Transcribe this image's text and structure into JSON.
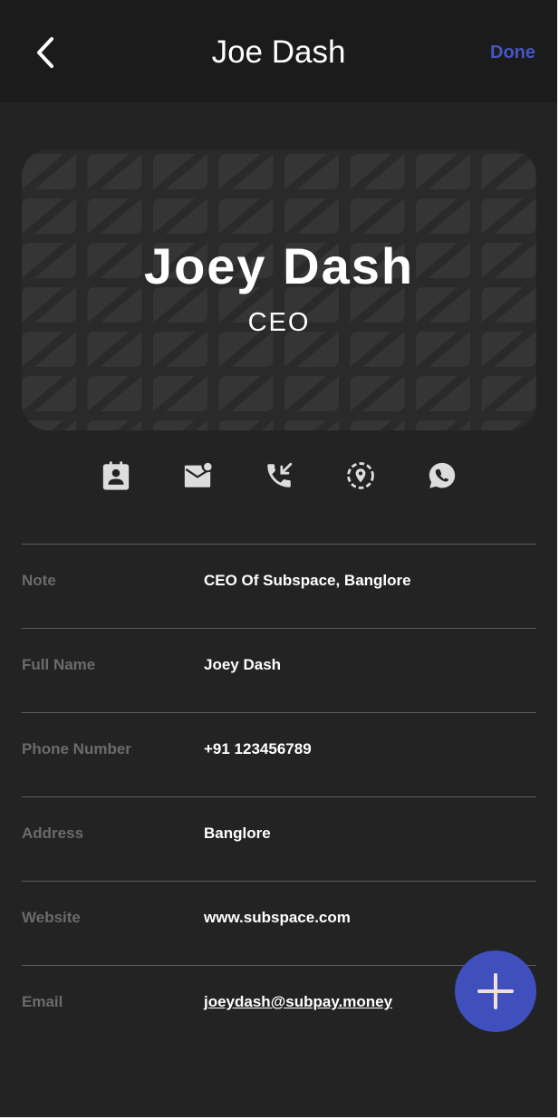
{
  "header": {
    "title": "Joe Dash",
    "done_label": "Done",
    "back_icon": "chevron-left-icon"
  },
  "card": {
    "name": "Joey Dash",
    "role": "CEO"
  },
  "actions": [
    {
      "icon": "contact-card-icon"
    },
    {
      "icon": "mail-notification-icon"
    },
    {
      "icon": "phone-callback-icon"
    },
    {
      "icon": "location-pin-icon"
    },
    {
      "icon": "whatsapp-icon"
    }
  ],
  "details": [
    {
      "label": "Note",
      "value": "CEO Of Subspace, Banglore"
    },
    {
      "label": "Full Name",
      "value": "Joey Dash"
    },
    {
      "label": "Phone Number",
      "value": "+91 123456789"
    },
    {
      "label": "Address",
      "value": "Banglore"
    },
    {
      "label": "Website",
      "value": "www.subspace.com"
    },
    {
      "label": "Email",
      "value": "joeydash@subpay.money"
    }
  ],
  "fab": {
    "icon": "plus-icon"
  },
  "colors": {
    "background": "#232323",
    "header": "#1b1b1b",
    "accent": "#3f50bd",
    "done_text": "#4556c4",
    "label_text": "#6b6b6b"
  }
}
